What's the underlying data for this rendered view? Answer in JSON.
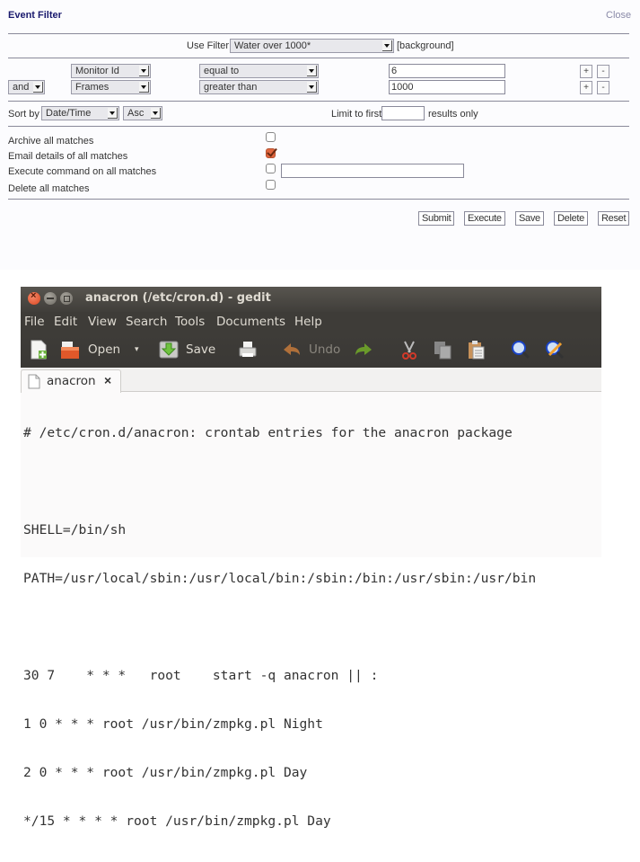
{
  "filter_panel": {
    "title": "Event Filter",
    "close_label": "Close",
    "use_filter": {
      "label": "Use Filter",
      "selected": "Water over 1000*",
      "suffix": "[background]"
    },
    "terms": [
      {
        "conjunction": "",
        "attribute": "Monitor Id",
        "operator": "equal to",
        "value": "6",
        "add_label": "+",
        "remove_label": "-"
      },
      {
        "conjunction": "and",
        "attribute": "Frames",
        "operator": "greater than",
        "value": "1000",
        "add_label": "+",
        "remove_label": "-"
      }
    ],
    "sort": {
      "label": "Sort by",
      "field": "Date/Time",
      "direction": "Asc"
    },
    "limit": {
      "label_before": "Limit to first",
      "value": "",
      "label_after": "results only"
    },
    "actions": [
      {
        "label": "Archive all matches",
        "checked": false
      },
      {
        "label": "Email details of all matches",
        "checked": true
      },
      {
        "label": "Execute command on all matches",
        "checked": false,
        "command": ""
      },
      {
        "label": "Delete all matches",
        "checked": false
      }
    ],
    "buttons": {
      "submit": "Submit",
      "execute": "Execute",
      "save": "Save",
      "delete": "Delete",
      "reset": "Reset"
    }
  },
  "gedit": {
    "window_title": "anacron (/etc/cron.d) - gedit",
    "menu": [
      "File",
      "Edit",
      "View",
      "Search",
      "Tools",
      "Documents",
      "Help"
    ],
    "toolbar": {
      "new_icon": "new-document-icon",
      "open_label": "Open",
      "save_label": "Save",
      "print_icon": "print-icon",
      "undo_label": "Undo",
      "redo_icon": "redo-icon",
      "cut_icon": "cut-icon",
      "copy_icon": "copy-icon",
      "paste_icon": "paste-icon",
      "find_icon": "find-icon",
      "replace_icon": "find-replace-icon"
    },
    "tab": {
      "label": "anacron",
      "close_label": "×"
    },
    "lines": [
      "# /etc/cron.d/anacron: crontab entries for the anacron package",
      "",
      "SHELL=/bin/sh",
      "PATH=/usr/local/sbin:/usr/local/bin:/sbin:/bin:/usr/sbin:/usr/bin",
      "",
      "30 7    * * *   root    start -q anacron || :",
      "1 0 * * * root /usr/bin/zmpkg.pl Night",
      "2 0 * * * root /usr/bin/zmpkg.pl Day",
      "*/15 * * * * root /usr/bin/zmpkg.pl Day"
    ]
  },
  "colors": {
    "title_blue": "#1a1a6e",
    "checkbox_orange": "#e0663e",
    "gedit_dark": "#3e3c38",
    "close_red": "#d8451f"
  }
}
